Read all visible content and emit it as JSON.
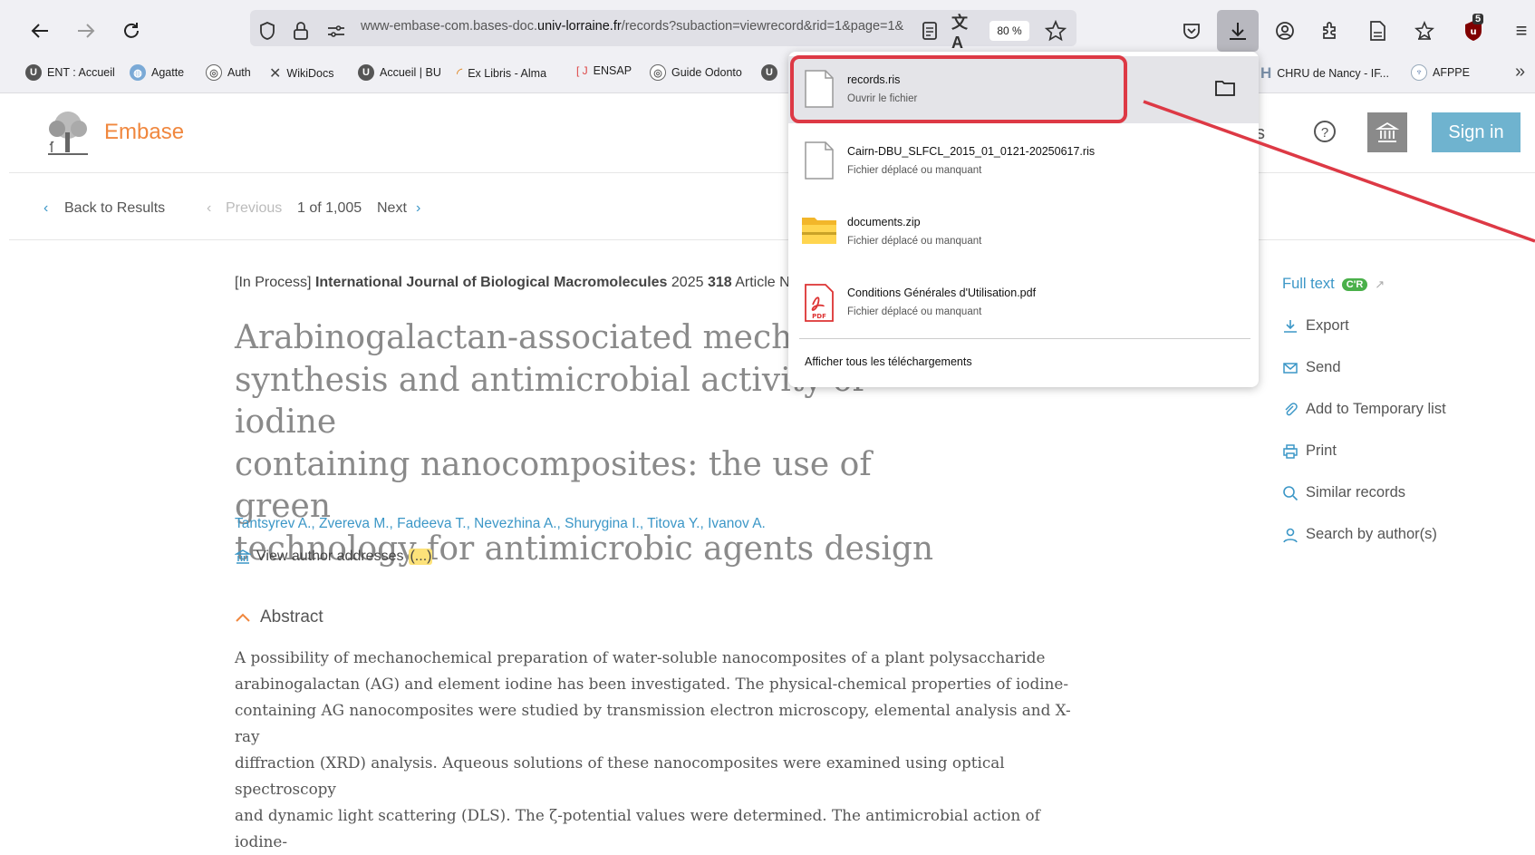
{
  "browser": {
    "url_prefix": "www-embase-com.bases-doc.",
    "url_domain": "univ-lorraine.fr",
    "url_path": "/records?subaction=viewrecord&rid=1&page=1&",
    "zoom": "80 %",
    "badge_count": "5"
  },
  "bookmarks": [
    {
      "label": "ENT : Accueil"
    },
    {
      "label": "Agatte"
    },
    {
      "label": "Auth"
    },
    {
      "label": "WikiDocs"
    },
    {
      "label": "Accueil | BU"
    },
    {
      "label": "Ex Libris - Alma"
    },
    {
      "label": "ENSAP"
    },
    {
      "label": "Guide Odonto"
    },
    {
      "label": "CHRU de Nancy - IF..."
    },
    {
      "label": "AFPPE"
    }
  ],
  "downloads": {
    "items": [
      {
        "name": "records.ris",
        "status": "Ouvrir le fichier",
        "type": "generic"
      },
      {
        "name": "Cairn-DBU_SLFCL_2015_01_0121-20250617.ris",
        "status": "Fichier déplacé ou manquant",
        "type": "generic"
      },
      {
        "name": "documents.zip",
        "status": "Fichier déplacé ou manquant",
        "type": "folder"
      },
      {
        "name": "Conditions Générales d'Utilisation.pdf",
        "status": "Fichier déplacé ou manquant",
        "type": "pdf"
      }
    ],
    "show_all": "Afficher tous les téléchargements"
  },
  "header": {
    "logo": "Embase",
    "sign_in": "Sign in"
  },
  "results_nav": {
    "back": "Back to Results",
    "previous": "Previous",
    "position": "1 of 1,005",
    "next": "Next"
  },
  "record": {
    "status": "[In Process]",
    "journal": "International Journal of Biological Macromolecules",
    "year": "2025",
    "volume": "318",
    "article": "Article Nu",
    "title_lines": [
      "Arabinogalactan-associated mechano",
      "synthesis and antimicrobial activity of iodine",
      "containing nanocomposites: the use of green",
      "technology for antimicrobic agents design"
    ],
    "authors": "Tantsyrev A., Zvereva M., Fadeeva T., Nevezhina A., Shurygina I., Titova Y., Ivanov A.",
    "view_addresses": "View author addresses",
    "ellipsis": "(...)",
    "abstract_heading": "Abstract",
    "abstract_lines": [
      "A possibility of mechanochemical preparation of water-soluble nanocomposites of a plant polysaccharide",
      "arabinogalactan (AG) and element iodine has been investigated. The physical-chemical properties of iodine-",
      "containing AG nanocomposites were studied by transmission electron microscopy, elemental analysis and X-ray",
      "diffraction (XRD) analysis. Aqueous solutions of these nanocomposites were examined using optical spectroscopy",
      "and dynamic light scattering (DLS). The ζ-potential values were determined. The antimicrobial action of iodine-"
    ]
  },
  "sidebar": {
    "full_text": "Full text",
    "full_text_badge": "C'R",
    "export": "Export",
    "send": "Send",
    "add_temp": "Add to Temporary list",
    "print": "Print",
    "similar": "Similar records",
    "search_author": "Search by author(s)",
    "partial_s": "s"
  }
}
